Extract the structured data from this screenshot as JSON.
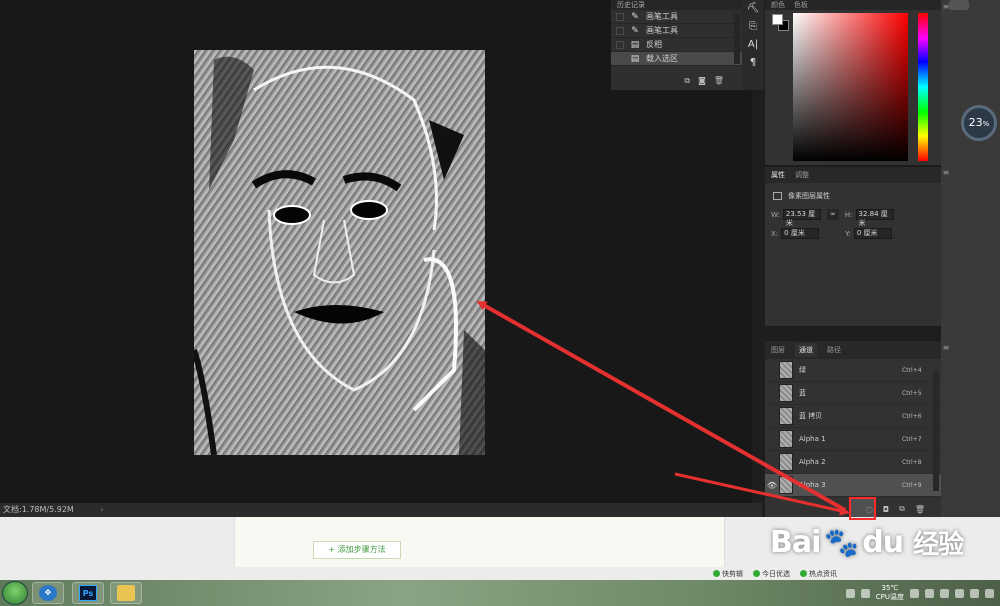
{
  "history": {
    "header": "历史记录",
    "items": [
      {
        "label": "画笔工具",
        "icon": "brush-icon",
        "active": false
      },
      {
        "label": "画笔工具",
        "icon": "brush-icon",
        "active": false
      },
      {
        "label": "反相",
        "icon": "document-icon",
        "active": false
      },
      {
        "label": "载入选区",
        "icon": "document-icon",
        "active": true
      }
    ]
  },
  "color_panel": {
    "tab1": "颜色",
    "tab2": "色板",
    "fg": "#ffffff",
    "bg": "#000000"
  },
  "properties": {
    "tab1": "属性",
    "tab2": "调整",
    "title": "像素图层属性",
    "w_label": "W:",
    "w_value": "23.53 厘米",
    "h_label": "H:",
    "h_value": "32.84 厘米",
    "x_label": "X:",
    "x_value": "0 厘米",
    "y_label": "Y:",
    "y_value": "0 厘米"
  },
  "channels": {
    "tabs": [
      "图层",
      "通道",
      "路径"
    ],
    "active_tab": "通道",
    "rows": [
      {
        "name": "绿",
        "shortcut": "Ctrl+4",
        "visible": false
      },
      {
        "name": "蓝",
        "shortcut": "Ctrl+5",
        "visible": false
      },
      {
        "name": "蓝 拷贝",
        "shortcut": "Ctrl+6",
        "visible": false
      },
      {
        "name": "Alpha 1",
        "shortcut": "Ctrl+7",
        "visible": false
      },
      {
        "name": "Alpha 2",
        "shortcut": "Ctrl+8",
        "visible": false
      },
      {
        "name": "Alpha 3",
        "shortcut": "Ctrl+9",
        "visible": true
      }
    ]
  },
  "status": {
    "doc_size": "文档:1.78M/5.92M",
    "chevron": "›"
  },
  "zoom_badge": {
    "value": "23",
    "unit": "%"
  },
  "webpage": {
    "add_step": "+ 添加步骤方法",
    "watermark_brand": "Bai",
    "watermark_paw": "🐾",
    "watermark_du": "du",
    "watermark_jingyan": "经验",
    "download_items": [
      "快剪辑",
      "今日优选",
      "热点资讯"
    ]
  },
  "taskbar": {
    "apps": [
      {
        "name": "app-blue",
        "label": ""
      },
      {
        "name": "photoshop",
        "label": "Ps"
      },
      {
        "name": "folder",
        "label": ""
      }
    ],
    "temp": "35℃",
    "cpu_label": "CPU温度"
  }
}
